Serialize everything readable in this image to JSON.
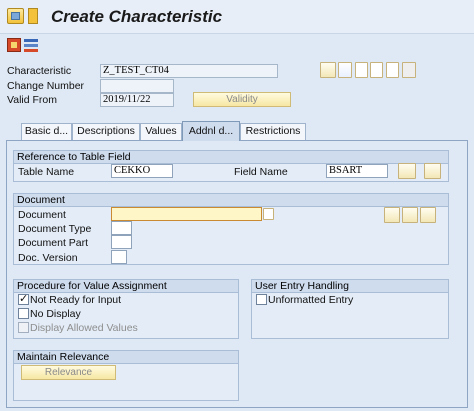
{
  "window": {
    "title": "Create Characteristic"
  },
  "header": {
    "characteristic_label": "Characteristic",
    "characteristic_value": "Z_TEST_CT04",
    "change_number_label": "Change Number",
    "change_number_value": "",
    "valid_from_label": "Valid From",
    "valid_from_value": "2019/11/22",
    "validity_button": "Validity"
  },
  "tabs": [
    {
      "label": "Basic d..."
    },
    {
      "label": "Descriptions"
    },
    {
      "label": "Values"
    },
    {
      "label": "Addnl d..."
    },
    {
      "label": "Restrictions"
    }
  ],
  "reference": {
    "title": "Reference to Table Field",
    "table_name_label": "Table Name",
    "table_name_value": "CEKKO",
    "field_name_label": "Field Name",
    "field_name_value": "BSART"
  },
  "document": {
    "title": "Document",
    "document_label": "Document",
    "document_value": "",
    "document_type_label": "Document Type",
    "document_type_value": "",
    "document_part_label": "Document Part",
    "document_part_value": "",
    "doc_version_label": "Doc. Version",
    "doc_version_value": ""
  },
  "procedure": {
    "title": "Procedure for Value Assignment",
    "not_ready_label": "Not Ready for Input",
    "not_ready_checked": true,
    "no_display_label": "No Display",
    "display_allowed_label": "Display Allowed Values"
  },
  "user_entry": {
    "title": "User Entry Handling",
    "unformatted_label": "Unformatted Entry"
  },
  "relevance": {
    "title": "Maintain Relevance",
    "relevance_button": "Relevance"
  }
}
